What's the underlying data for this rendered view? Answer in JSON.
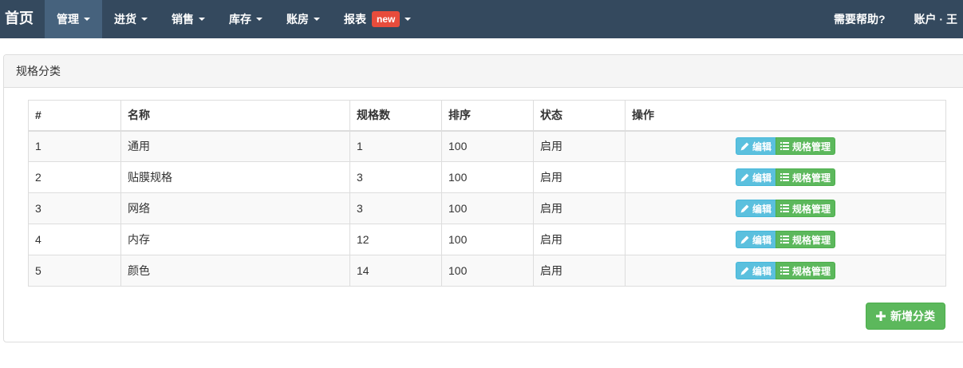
{
  "navbar": {
    "brand": "首页",
    "items": [
      {
        "label": "管理",
        "active": true
      },
      {
        "label": "进货"
      },
      {
        "label": "销售"
      },
      {
        "label": "库存"
      },
      {
        "label": "账房"
      },
      {
        "label": "报表",
        "badge": "new"
      }
    ],
    "right": {
      "help": "需要帮助?",
      "account": "账户 · 王"
    }
  },
  "panel": {
    "title": "规格分类"
  },
  "table": {
    "headers": [
      "#",
      "名称",
      "规格数",
      "排序",
      "状态",
      "操作"
    ],
    "rows": [
      {
        "id": "1",
        "name": "通用",
        "count": "1",
        "order": "100",
        "status": "启用"
      },
      {
        "id": "2",
        "name": "贴膜规格",
        "count": "3",
        "order": "100",
        "status": "启用"
      },
      {
        "id": "3",
        "name": "网络",
        "count": "3",
        "order": "100",
        "status": "启用"
      },
      {
        "id": "4",
        "name": "内存",
        "count": "12",
        "order": "100",
        "status": "启用"
      },
      {
        "id": "5",
        "name": "颜色",
        "count": "14",
        "order": "100",
        "status": "启用"
      }
    ],
    "edit_label": "编辑",
    "spec_label": "规格管理"
  },
  "add_button": {
    "label": "新增分类"
  },
  "colors": {
    "navbar": "#34495e",
    "active": "#46627d",
    "info": "#5bc0de",
    "success": "#5cb85c",
    "badge": "#e74c3c"
  }
}
